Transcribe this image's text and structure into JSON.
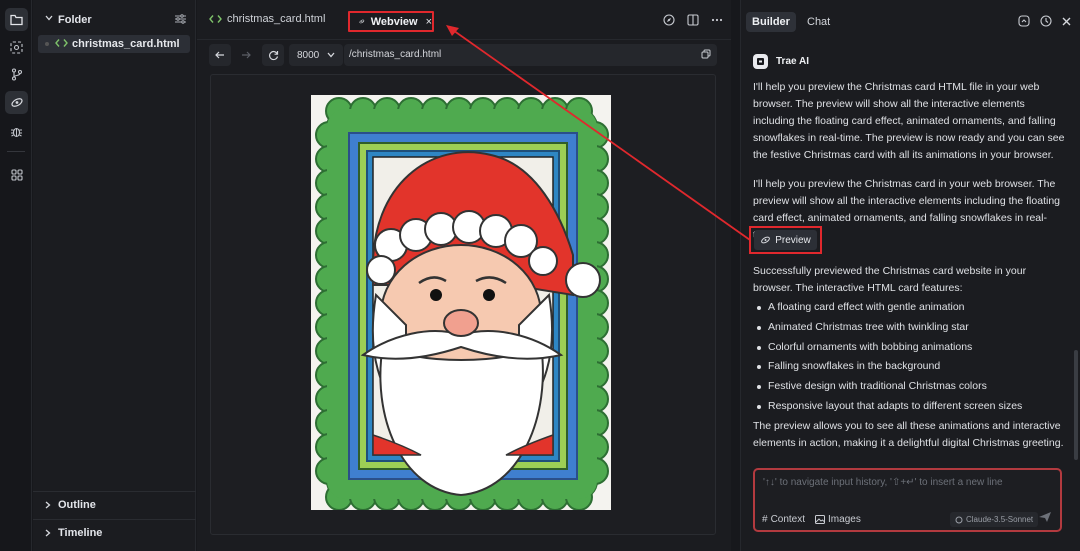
{
  "explorer": {
    "folder_title": "Folder",
    "file_name": "christmas_card.html",
    "outline_title": "Outline",
    "timeline_title": "Timeline"
  },
  "editor": {
    "tab_file": "christmas_card.html",
    "tab_webview": "Webview",
    "tab_close": "×",
    "port": "8000",
    "url": "/christmas_card.html"
  },
  "panel": {
    "tab_builder": "Builder",
    "tab_chat": "Chat",
    "bot_name": "Trae AI",
    "para1": "I'll help you preview the Christmas card HTML file in your web browser. The preview will show all the interactive elements including the floating card effect, animated ornaments, and falling snowflakes in real-time. The preview is now ready and you can see the festive Christmas card with all its animations in your browser.",
    "para2": "I'll help you preview the Christmas card in your web browser. The preview will show all the interactive elements including the floating card effect, animated ornaments, and falling snowflakes in real-time.",
    "preview_label": "Preview",
    "para3": "Successfully previewed the Christmas card website in your browser. The interactive HTML card features:",
    "bullets": [
      "A floating card effect with gentle animation",
      "Animated Christmas tree with twinkling star",
      "Colorful ornaments with bobbing animations",
      "Falling snowflakes in the background",
      "Festive design with traditional Christmas colors",
      "Responsive layout that adapts to different screen sizes"
    ],
    "para4": "The preview allows you to see all these animations and interactive elements in action, making it a delightful digital Christmas greeting.",
    "input_placeholder": "'↑↓' to navigate input history, '⇧+↵' to insert a new line",
    "context_label": "Context",
    "images_label": "Images",
    "model_label": "Claude-3.5-Sonnet"
  },
  "colors": {
    "highlight": "#e0282d",
    "accent_green": "#7ec26a"
  }
}
